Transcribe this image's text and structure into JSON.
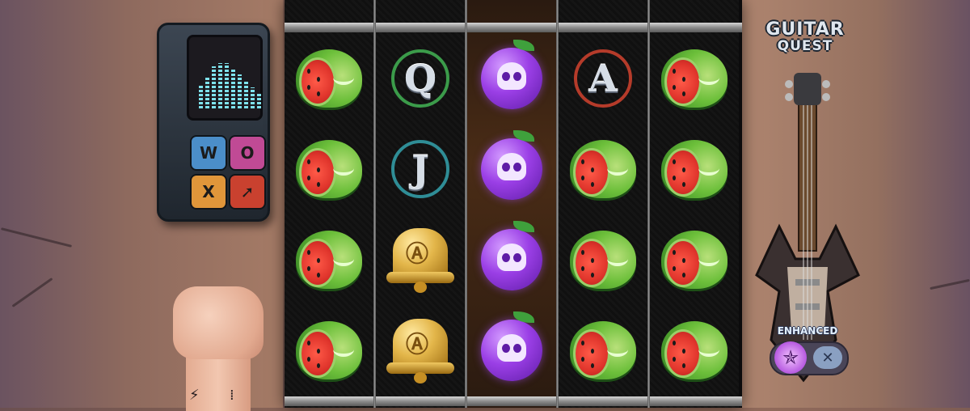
{
  "game": {
    "logo_line1": "GUITAR",
    "logo_line2": "QUEST",
    "enhanced_label": "ENHANCED",
    "enhanced_toggle_x": "✕"
  },
  "device": {
    "buttons": [
      "W",
      "O",
      "X",
      "➚"
    ]
  },
  "reels": {
    "columns": 5,
    "rows": 4,
    "grid": [
      [
        "watermelon",
        "watermelon",
        "watermelon",
        "watermelon"
      ],
      [
        "Q",
        "J",
        "bell",
        "bell"
      ],
      [
        "plum",
        "plum",
        "plum",
        "plum"
      ],
      [
        "A",
        "watermelon",
        "watermelon",
        "watermelon"
      ],
      [
        "watermelon",
        "watermelon",
        "watermelon",
        "watermelon"
      ]
    ],
    "letter_ring_colors": {
      "Q": "#3b9b4a",
      "J": "#2f8d96",
      "A": "#b53b2a"
    },
    "highlighted_reel_index": 2
  },
  "icons": {
    "enhanced_symbol": "pentagram-icon",
    "fist": "fist-icon",
    "tattoo_left": "⚡",
    "tattoo_right": "⁞"
  }
}
